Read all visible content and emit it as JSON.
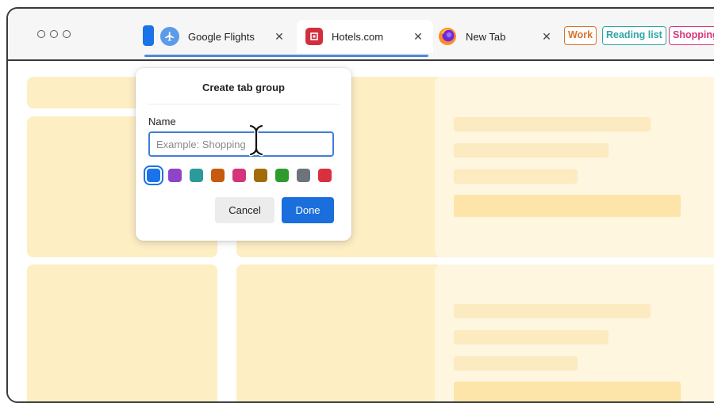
{
  "browser": {
    "tabs": [
      {
        "title": "Google Flights",
        "icon": "google-flights-icon"
      },
      {
        "title": "Hotels.com",
        "icon": "hotels-com-icon"
      },
      {
        "title": "New Tab",
        "icon": "firefox-icon"
      }
    ],
    "close_glyph": "✕",
    "tab_groups": [
      {
        "label": "Work",
        "color": "#d9732a"
      },
      {
        "label": "Reading list",
        "color": "#2ea6a6"
      },
      {
        "label": "Shopping",
        "color": "#d8367a"
      }
    ],
    "active_group_color": "#1a73e8"
  },
  "dialog": {
    "title": "Create tab group",
    "name_label": "Name",
    "name_placeholder": "Example: Shopping",
    "name_value": "",
    "colors": [
      "#1a73e8",
      "#8e44c7",
      "#2a9a9a",
      "#c65a0e",
      "#d6337a",
      "#a36b0c",
      "#2e9b2e",
      "#6c737a",
      "#d93040"
    ],
    "selected_color": "#1a73e8",
    "cancel_label": "Cancel",
    "done_label": "Done"
  }
}
